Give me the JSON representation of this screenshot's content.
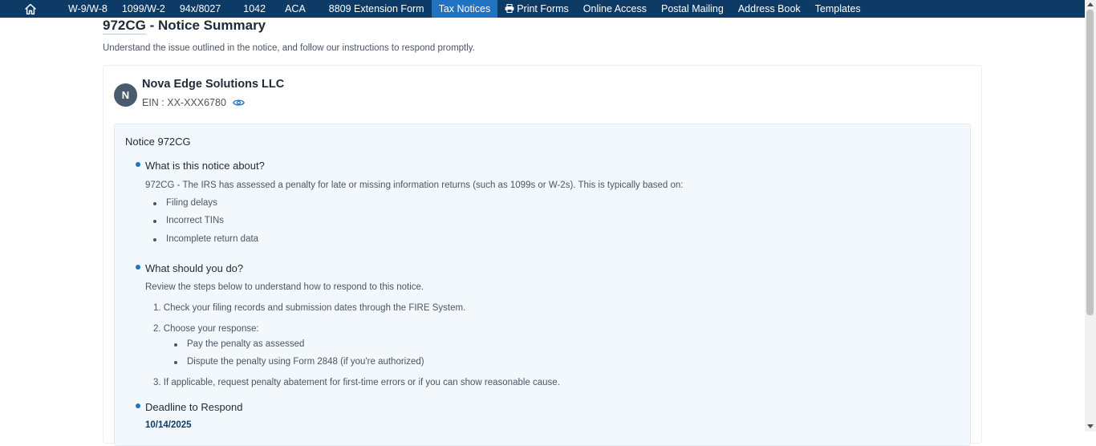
{
  "nav": {
    "home_icon": "home-icon",
    "items": [
      "W-9/W-8",
      "1099/W-2",
      "94x/8027",
      "1042",
      "ACA",
      "8809 Extension Form",
      "Tax Notices",
      "Print Forms",
      "Online Access",
      "Postal Mailing",
      "Address Book",
      "Templates"
    ],
    "active": "Tax Notices",
    "print_icon": "printer-icon"
  },
  "page": {
    "title_code": "972CG",
    "title_rest": " - Notice Summary",
    "subtitle": "Understand the issue outlined in the notice, and follow our instructions to respond promptly."
  },
  "company": {
    "avatar_letter": "N",
    "name": "Nova Edge Solutions LLC",
    "ein": "EIN : XX-XXX6780",
    "eye_icon": "eye-icon"
  },
  "notice": {
    "title": "Notice 972CG",
    "about": {
      "heading": "What is this notice about?",
      "intro": "972CG - The IRS has assessed a penalty for late or missing information returns (such as 1099s or W-2s). This is typically based on:",
      "bullets": [
        "Filing delays",
        "Incorrect TINs",
        "Incomplete return data"
      ]
    },
    "todo": {
      "heading": "What should you do?",
      "intro": "Review the steps below to understand how to respond to this notice.",
      "step1": "1. Check your filing records and submission dates through the FIRE System.",
      "step2": "2. Choose your response:",
      "step2_options": [
        "Pay the penalty as assessed",
        "Dispute the penalty using Form 2848 (if you're authorized)"
      ],
      "step3": "3. If applicable, request penalty abatement for first-time errors or if you can show reasonable cause."
    },
    "deadline": {
      "heading": "Deadline to Respond",
      "date": "10/14/2025"
    }
  },
  "colors": {
    "nav_bg": "#0d3b66",
    "nav_active": "#1f73c2",
    "panel_bg": "#f3f8fc",
    "accent": "#1f73c2"
  }
}
